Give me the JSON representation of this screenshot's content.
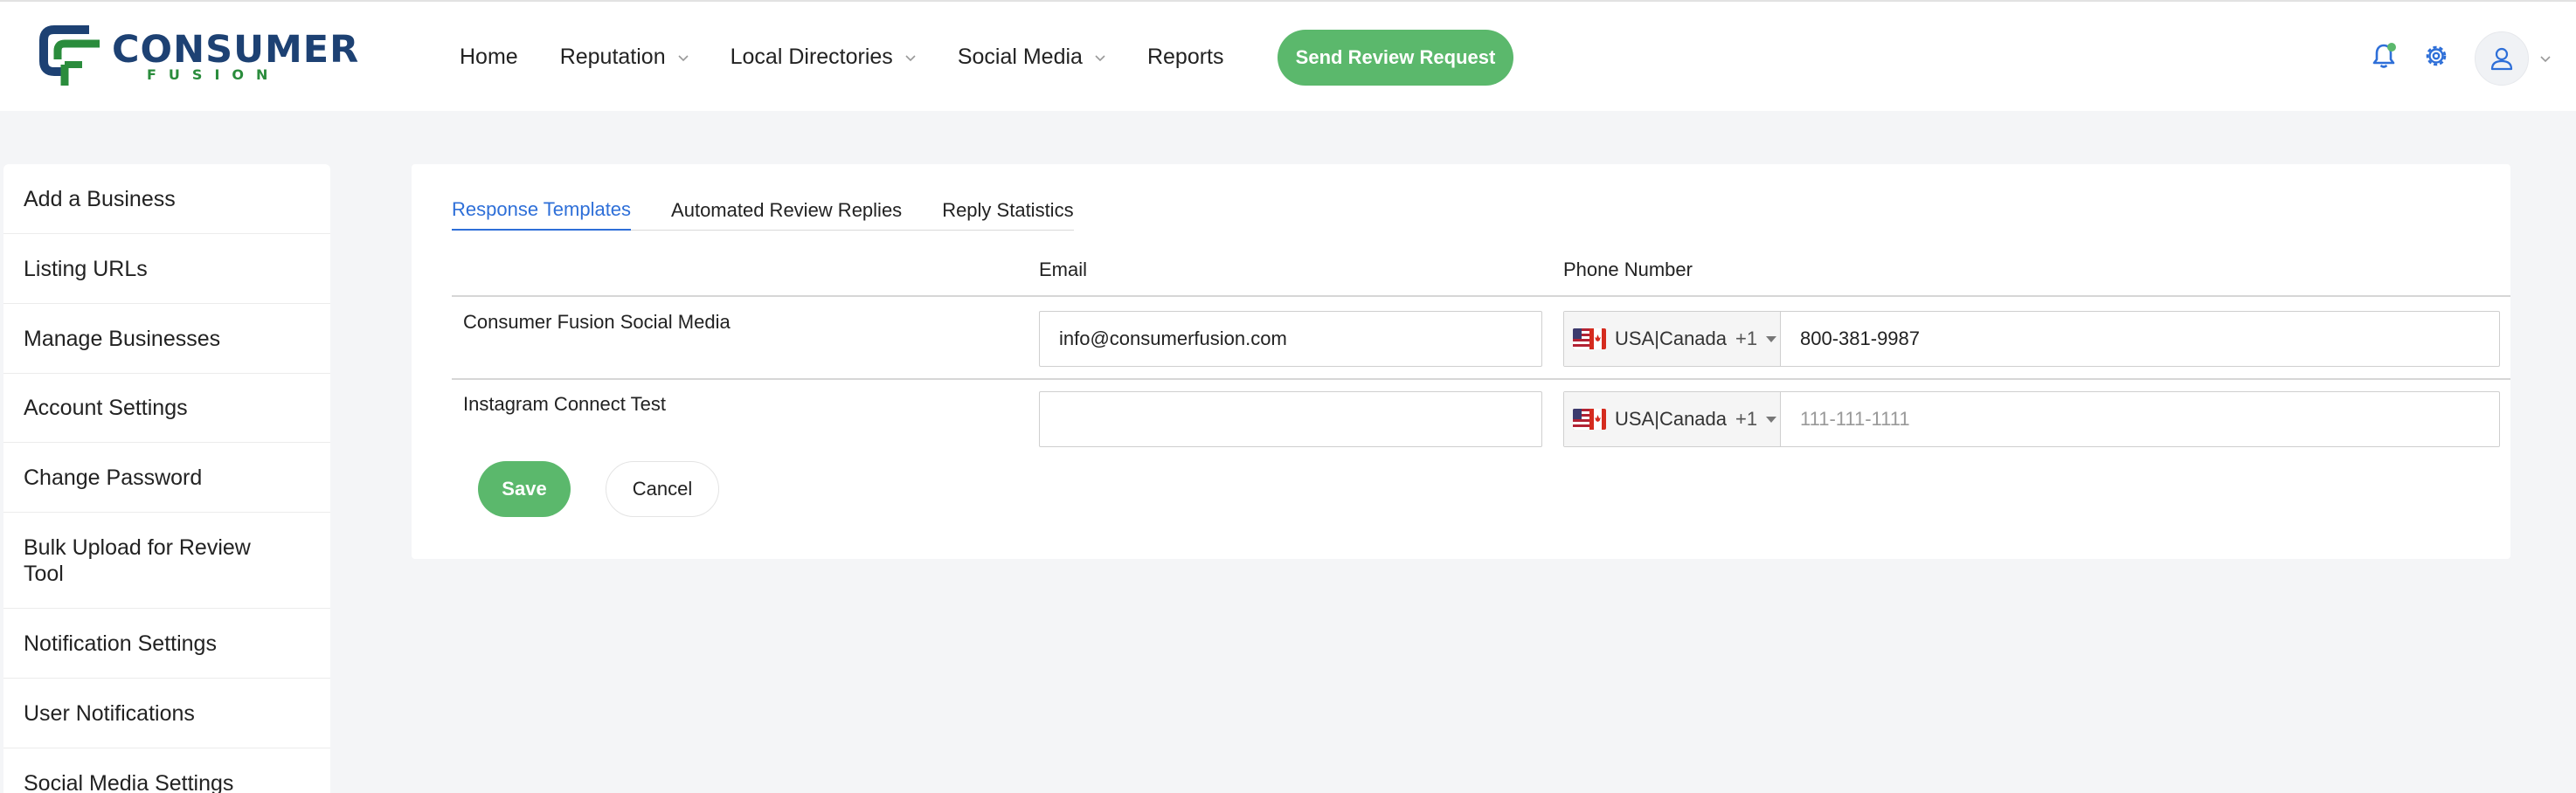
{
  "brand": {
    "name": "CONSUMER",
    "tagline": "FUSION"
  },
  "nav": {
    "items": [
      {
        "label": "Home",
        "has_dropdown": false
      },
      {
        "label": "Reputation",
        "has_dropdown": true
      },
      {
        "label": "Local Directories",
        "has_dropdown": true
      },
      {
        "label": "Social Media",
        "has_dropdown": true
      },
      {
        "label": "Reports",
        "has_dropdown": false
      }
    ],
    "cta_label": "Send Review Request"
  },
  "header_icons": [
    "bell-icon",
    "gear-icon",
    "user-icon",
    "chevron-down-icon"
  ],
  "sidebar": {
    "items": [
      {
        "label": "Add a Business"
      },
      {
        "label": "Listing URLs"
      },
      {
        "label": "Manage Businesses"
      },
      {
        "label": "Account Settings"
      },
      {
        "label": "Change Password"
      },
      {
        "label": "Bulk Upload for Review Tool"
      },
      {
        "label": "Notification Settings"
      },
      {
        "label": "User Notifications"
      },
      {
        "label": "Social Media Settings"
      }
    ]
  },
  "tabs": [
    {
      "label": "Response Templates",
      "active": true
    },
    {
      "label": "Automated Review Replies",
      "active": false
    },
    {
      "label": "Reply Statistics",
      "active": false
    }
  ],
  "table": {
    "columns": {
      "email": "Email",
      "phone": "Phone Number"
    },
    "rows": [
      {
        "name": "Consumer Fusion Social Media",
        "email": "info@consumerfusion.com",
        "email_placeholder": "",
        "country": "USA|Canada",
        "dial_code": "+1",
        "phone": "800-381-9987",
        "phone_placeholder": ""
      },
      {
        "name": "Instagram Connect Test",
        "email": "",
        "email_placeholder": "",
        "country": "USA|Canada",
        "dial_code": "+1",
        "phone": "",
        "phone_placeholder": "111-111-1111"
      }
    ]
  },
  "actions": {
    "save_label": "Save",
    "cancel_label": "Cancel"
  },
  "colors": {
    "accent_green": "#5bb86c",
    "active_tab_blue": "#2e6fd8",
    "brand_navy": "#1d4173",
    "brand_green": "#2a8c3c"
  }
}
